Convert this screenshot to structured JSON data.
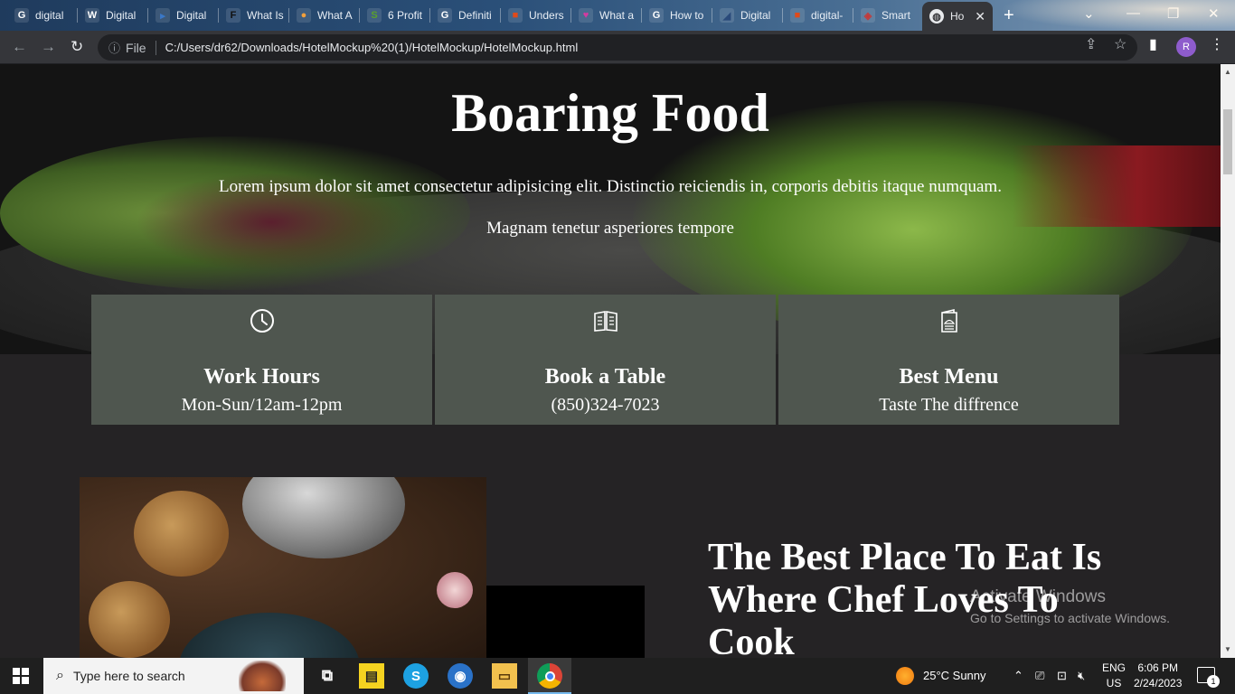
{
  "browser": {
    "tabs": [
      {
        "label": "digital",
        "favicon": "G",
        "color": "#ffffff"
      },
      {
        "label": "Digital",
        "favicon": "W",
        "color": "#ffffff"
      },
      {
        "label": "Digital",
        "favicon": "▸",
        "color": "#3a78c8"
      },
      {
        "label": "What Is",
        "favicon": "F",
        "color": "#111111"
      },
      {
        "label": "What A",
        "favicon": "●",
        "color": "#f3a03c"
      },
      {
        "label": "6 Profit",
        "favicon": "S",
        "color": "#5aa02c"
      },
      {
        "label": "Definiti",
        "favicon": "G",
        "color": "#ffffff"
      },
      {
        "label": "Unders",
        "favicon": "■",
        "color": "#e04a1a"
      },
      {
        "label": "What a",
        "favicon": "♥",
        "color": "#d43aa0"
      },
      {
        "label": "How to",
        "favicon": "G",
        "color": "#ffffff"
      },
      {
        "label": "Digital",
        "favicon": "◢",
        "color": "#2a4a7a"
      },
      {
        "label": "digital-",
        "favicon": "■",
        "color": "#e04a1a"
      },
      {
        "label": "Smart",
        "favicon": "◈",
        "color": "#c43a3a"
      }
    ],
    "active_tab": {
      "label": "Ho",
      "favicon": "globe-icon"
    },
    "address": {
      "scheme_label": "File",
      "url": "C:/Users/dr62/Downloads/HotelMockup%20(1)/HotelMockup/HotelMockup.html"
    },
    "profile_initial": "R"
  },
  "hero": {
    "title": "Boaring Food",
    "line1": "Lorem ipsum dolor sit amet consectetur adipisicing elit. Distinctio reiciendis in, corporis debitis itaque numquam.",
    "line2": "Magnam tenetur asperiores tempore"
  },
  "cards": [
    {
      "icon": "clock-icon",
      "title": "Work Hours",
      "value": "Mon-Sun/12am-12pm"
    },
    {
      "icon": "book-icon",
      "title": "Book a Table",
      "value": "(850)324-7023"
    },
    {
      "icon": "menu-card-icon",
      "title": "Best Menu",
      "value": "Taste The diffrence"
    }
  ],
  "about": {
    "title_line1": "The Best Place To Eat Is",
    "title_line2": "Where Chef Loves To",
    "title_line3": "Cook"
  },
  "watermark": {
    "line1": "Activate Windows",
    "line2": "Go to Settings to activate Windows."
  },
  "taskbar": {
    "search_placeholder": "Type here to search",
    "weather": "25°C  Sunny",
    "lang_line1": "ENG",
    "lang_line2": "US",
    "time": "6:06 PM",
    "date": "2/24/2023",
    "notification_count": "1"
  },
  "colors": {
    "page_bg": "#252325",
    "card_bg": "#4f564f",
    "chrome_toolbar": "#35363a"
  }
}
